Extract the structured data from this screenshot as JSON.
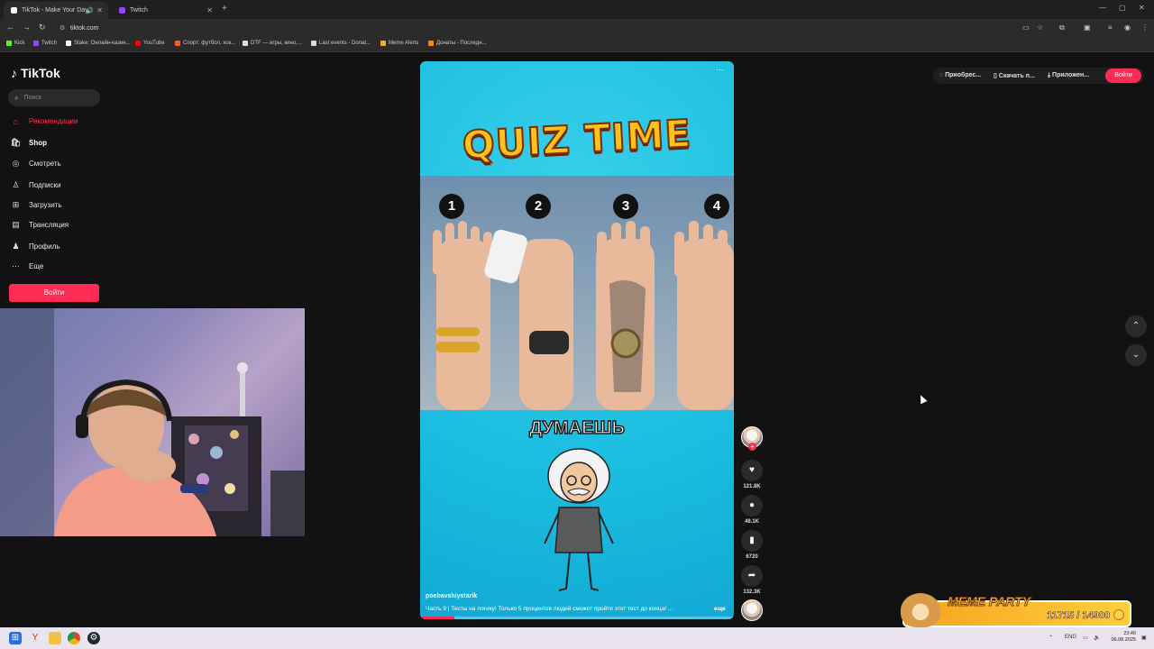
{
  "browser": {
    "tabs": [
      {
        "title": "TikTok - Make Your Day",
        "active": true,
        "favicon_color": "#ffffff"
      },
      {
        "title": "Twitch",
        "active": false,
        "favicon_color": "#9146ff"
      }
    ],
    "new_tab_label": "+",
    "url": "tiktok.com",
    "bookmarks": [
      {
        "label": "Kick",
        "color": "#53fc18"
      },
      {
        "label": "Twitch",
        "color": "#9146ff"
      },
      {
        "label": "Stake: Онлайн-казин...",
        "color": "#ffffff"
      },
      {
        "label": "YouTube",
        "color": "#ff0000"
      },
      {
        "label": "Спорт: футбол, хок...",
        "color": "#ff5a1f"
      },
      {
        "label": "DTF — игры, кино,...",
        "color": "#dddddd"
      },
      {
        "label": "Last events - Donat...",
        "color": "#dddddd"
      },
      {
        "label": "Meme Alerts",
        "color": "#f2b01e"
      },
      {
        "label": "Донаты - Последн...",
        "color": "#ff8a00"
      }
    ]
  },
  "tiktok": {
    "logo": "TikTok",
    "search_placeholder": "Поиск",
    "nav": [
      {
        "label": "Рекомендации",
        "icon": "home-icon",
        "active": true
      },
      {
        "label": "Shop",
        "icon": "shop-icon",
        "bold": true
      },
      {
        "label": "Смотреть",
        "icon": "compass-icon"
      },
      {
        "label": "Подписки",
        "icon": "following-icon"
      },
      {
        "label": "Загрузить",
        "icon": "upload-icon"
      },
      {
        "label": "Трансляция",
        "icon": "live-icon"
      },
      {
        "label": "Профиль",
        "icon": "profile-icon"
      },
      {
        "label": "Еще",
        "icon": "more-icon"
      }
    ],
    "login_label": "Войти",
    "top_buttons": [
      {
        "label": "Приобрес...",
        "icon": "coin-icon"
      },
      {
        "label": "Скачать п...",
        "icon": "phone-icon"
      },
      {
        "label": "Приложен...",
        "icon": "download-icon"
      }
    ],
    "top_login_label": "Войти",
    "video": {
      "title_text": "QUIZ TIME",
      "numbers": [
        "1",
        "2",
        "3",
        "4"
      ],
      "caption": "ДУМАЕШЬ",
      "username": "poebavshiystarik",
      "description": "Часть 9 | Тесты на логику! Только 5 процентов людей сможет пройти этот тест до конца! ...",
      "more_label": "еще",
      "progress": 0.11
    },
    "actions": {
      "likes": "121.8K",
      "comments": "48.1K",
      "saves": "6720",
      "shares": "132.3K"
    }
  },
  "overlay": {
    "title": "MEME PARTY",
    "counter": "11715 / 14900"
  },
  "taskbar": {
    "lang": "ENG",
    "time": "23:40",
    "date": "06.08.2025"
  }
}
